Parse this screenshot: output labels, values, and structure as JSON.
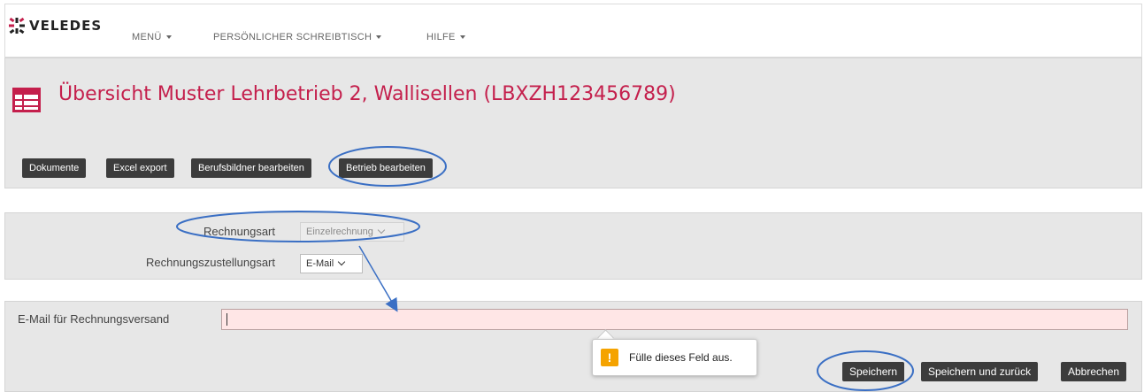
{
  "brand": {
    "name": "VELEDES"
  },
  "nav": {
    "items": [
      {
        "label": "MENÜ"
      },
      {
        "label": "PERSÖNLICHER SCHREIBTISCH"
      },
      {
        "label": "HILFE"
      }
    ]
  },
  "header": {
    "title": "Übersicht Muster Lehrbetrieb 2, Wallisellen (LBXZH123456789)",
    "buttons": [
      {
        "label": "Dokumente"
      },
      {
        "label": "Excel export"
      },
      {
        "label": "Berufsbildner bearbeiten"
      },
      {
        "label": "Betrieb bearbeiten"
      }
    ]
  },
  "billing": {
    "rechnungsart": {
      "label": "Rechnungsart",
      "value": "Einzelrechnung",
      "disabled": true
    },
    "zustellungsart": {
      "label": "Rechnungszustellungsart",
      "value": "E-Mail"
    }
  },
  "email": {
    "label": "E-Mail für Rechnungsversand",
    "value": "",
    "validation_message": "Fülle dieses Feld aus."
  },
  "actions": {
    "save": "Speichern",
    "save_back": "Speichern und zurück",
    "cancel": "Abbrechen"
  },
  "colors": {
    "title": "#c41f4c",
    "brand_accent": "#c41f4c",
    "button_bg": "#3c3c3c",
    "panel_bg": "#e7e7e7",
    "invalid_input_bg": "#ffe6e6",
    "warning": "#f5a300",
    "annotation": "#3a6fc4"
  },
  "icons": {
    "brand": "veledes-logo",
    "page": "table-icon",
    "warning": "exclamation-icon",
    "dropdown": "chevron-down-icon"
  }
}
